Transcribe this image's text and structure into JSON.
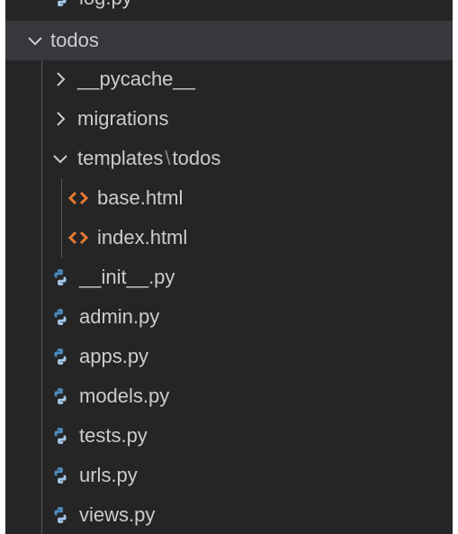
{
  "explorer": {
    "partial_top": {
      "label": "log.py"
    },
    "todos_folder": {
      "label": "todos",
      "expanded": true
    },
    "pycache_folder": {
      "label": "__pycache__",
      "expanded": false
    },
    "migrations_folder": {
      "label": "migrations",
      "expanded": false
    },
    "templates_folder": {
      "label": "templates",
      "separator": "\\",
      "sublabel": "todos",
      "expanded": true
    },
    "files": [
      {
        "label": "base.html",
        "type": "html"
      },
      {
        "label": "index.html",
        "type": "html"
      },
      {
        "label": "__init__.py",
        "type": "python"
      },
      {
        "label": "admin.py",
        "type": "python"
      },
      {
        "label": "apps.py",
        "type": "python"
      },
      {
        "label": "models.py",
        "type": "python"
      },
      {
        "label": "tests.py",
        "type": "python"
      },
      {
        "label": "urls.py",
        "type": "python"
      },
      {
        "label": "views.py",
        "type": "python"
      }
    ]
  },
  "colors": {
    "background": "#252526",
    "selected_row": "#37373d",
    "text": "#cccccc",
    "html_icon": "#e37933",
    "python_icon_blue": "#4b8bbe",
    "python_icon_light": "#a4c6e6"
  },
  "icons": {
    "chevron_collapsed": "chevron-right-icon",
    "chevron_expanded": "chevron-down-icon",
    "html_file": "html-file-icon",
    "python_file": "python-file-icon"
  }
}
